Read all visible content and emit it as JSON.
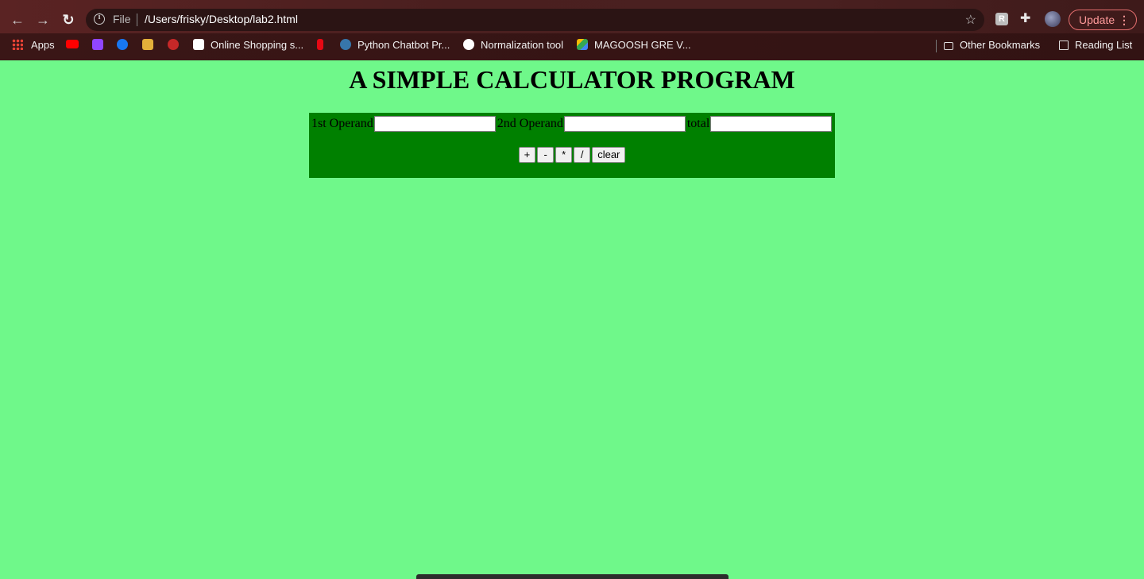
{
  "browser": {
    "scheme_label": "File",
    "url": "/Users/frisky/Desktop/lab2.html",
    "update_label": "Update",
    "bookmarks": [
      {
        "label": "Apps",
        "icon": "apps-grid-icon"
      },
      {
        "label": "",
        "icon": "youtube-icon",
        "color": "#ff0000"
      },
      {
        "label": "",
        "icon": "twitch-icon",
        "color": "#9146ff"
      },
      {
        "label": "",
        "icon": "facebook-icon",
        "color": "#1877f2"
      },
      {
        "label": "",
        "icon": "naruto-icon",
        "color": "#e3b03a"
      },
      {
        "label": "",
        "icon": "apple-icon",
        "color": "#c62828"
      },
      {
        "label": "Online Shopping s...",
        "icon": "amazon-icon",
        "color": "#ffffff"
      },
      {
        "label": "",
        "icon": "netflix-icon",
        "color": "#e50914"
      },
      {
        "label": "Python Chatbot Pr...",
        "icon": "python-icon",
        "color": "#3776ab"
      },
      {
        "label": "Normalization tool",
        "icon": "globe-icon",
        "color": "#ffffff"
      },
      {
        "label": "MAGOOSH GRE V...",
        "icon": "google-drive-icon",
        "color": "#34a853"
      }
    ],
    "other_bookmarks": "Other Bookmarks",
    "reading_list": "Reading List"
  },
  "page": {
    "title": "A SIMPLE CALCULATOR PROGRAM",
    "background": "#6ff88a",
    "panel_color": "#008000",
    "operand1_label": "1st Operand",
    "operand2_label": "2nd Operand",
    "total_label": "total",
    "operand1_value": "",
    "operand2_value": "",
    "total_value": "",
    "buttons": {
      "add": "+",
      "subtract": "-",
      "multiply": "*",
      "divide": "/",
      "clear": "clear"
    }
  }
}
